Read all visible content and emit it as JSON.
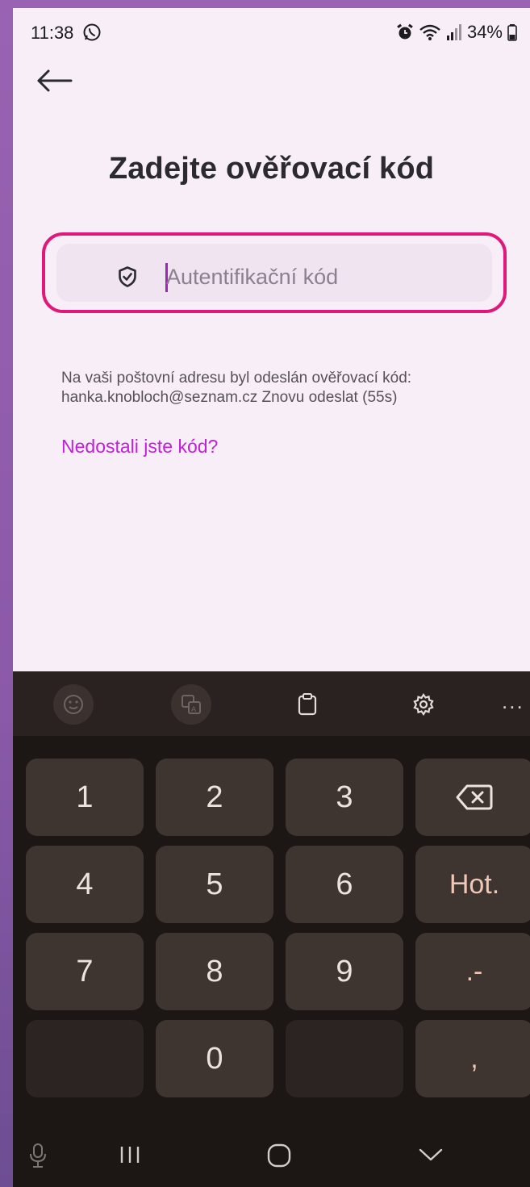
{
  "status_bar": {
    "time": "11:38",
    "battery": "34%",
    "icons": [
      "whatsapp-icon",
      "alarm-icon",
      "wifi-icon",
      "signal-icon",
      "battery-icon"
    ]
  },
  "header": {
    "back_icon": "arrow-left-icon",
    "title": "Zadejte ověřovací kód"
  },
  "code_field": {
    "icon": "shield-check-icon",
    "placeholder": "Autentifikační kód",
    "value": "",
    "border_color": "#e0187a"
  },
  "info": {
    "text": "Na vaši poštovní adresu byl odeslán ověřovací kód:",
    "email": "hanka.knobloch@seznam.cz",
    "resend": "Znovu odeslat (55s)"
  },
  "help_link": "Nedostali jste kód?",
  "keyboard": {
    "toolbar": [
      "emoji-icon",
      "translate-icon",
      "clipboard-icon",
      "settings-icon",
      "more-icon"
    ],
    "more_label": "...",
    "keys": [
      "1",
      "2",
      "3",
      "⌫",
      "4",
      "5",
      "6",
      "Hot.",
      "7",
      "8",
      "9",
      ".-",
      "",
      "0",
      "",
      ","
    ],
    "accent_color": "#f0c6b6"
  },
  "navbar": [
    "microphone-icon",
    "recent-apps-icon",
    "home-icon",
    "hide-keyboard-icon"
  ],
  "colors": {
    "background": "#f8eef8",
    "link": "#c020d8",
    "keyboard": "#1c1614",
    "key": "#3e3430"
  }
}
